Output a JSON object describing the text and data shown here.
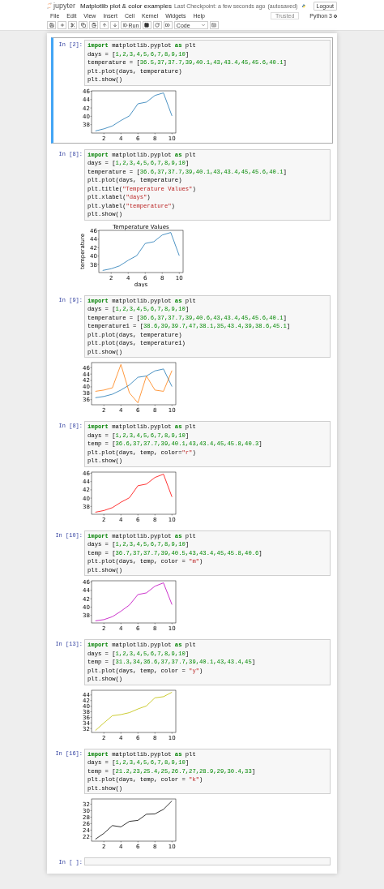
{
  "header": {
    "logo": "jupyter",
    "title": "Matplotlib plot & color examples",
    "checkpoint": "Last Checkpoint: a few seconds ago",
    "autosave": "(autosaved)",
    "logout": "Logout",
    "menu": [
      "File",
      "Edit",
      "View",
      "Insert",
      "Cell",
      "Kernel",
      "Widgets",
      "Help"
    ],
    "trusted": "Trusted",
    "kernel": "Python 3",
    "run": "Run",
    "cell_type": "Code"
  },
  "cells": [
    {
      "prompt": "In [2]:",
      "selected": true,
      "lines": [
        [
          {
            "text": "import",
            "kind": "keyword"
          },
          {
            "text": " matplotlib.pyplot ",
            "kind": "text"
          },
          {
            "text": "as",
            "kind": "keyword"
          },
          {
            "text": " plt",
            "kind": "text"
          }
        ],
        [
          {
            "text": "days = [",
            "kind": "text"
          },
          {
            "text": "1,2,3,4,5,6,7,8,9,10",
            "kind": "number"
          },
          {
            "text": "]",
            "kind": "text"
          }
        ],
        [
          {
            "text": "temperature = [",
            "kind": "text"
          },
          {
            "text": "36.5,37,37.7,39,40.1,43,43.4,45,45.6,40.1",
            "kind": "number"
          },
          {
            "text": "]",
            "kind": "text"
          }
        ],
        [
          {
            "text": "plt.plot(days, temperature)",
            "kind": "text"
          }
        ],
        [
          {
            "text": "plt.show()",
            "kind": "text"
          }
        ]
      ],
      "chart_data": {
        "type": "line",
        "x": [
          1,
          2,
          3,
          4,
          5,
          6,
          7,
          8,
          9,
          10
        ],
        "xlim": [
          0.55,
          10.45
        ],
        "ylim": [
          36,
          46.1
        ],
        "xticks": [
          2,
          4,
          6,
          8,
          10
        ],
        "yticks": [
          38,
          40,
          42,
          44,
          46
        ],
        "series": [
          {
            "color": "#1f77b4",
            "values": [
              36.5,
              37,
              37.7,
              39,
              40.1,
              43,
              43.4,
              45,
              45.6,
              40.1
            ]
          }
        ]
      }
    },
    {
      "prompt": "In [8]:",
      "selected": false,
      "lines": [
        [
          {
            "text": "import",
            "kind": "keyword"
          },
          {
            "text": " matplotlib.pyplot ",
            "kind": "text"
          },
          {
            "text": "as",
            "kind": "keyword"
          },
          {
            "text": " plt",
            "kind": "text"
          }
        ],
        [
          {
            "text": "days = [",
            "kind": "text"
          },
          {
            "text": "1,2,3,4,5,6,7,8,9,10",
            "kind": "number"
          },
          {
            "text": "]",
            "kind": "text"
          }
        ],
        [
          {
            "text": "temperature = [",
            "kind": "text"
          },
          {
            "text": "36.6,37,37.7,39,40.1,43,43.4,45,45.6,40.1",
            "kind": "number"
          },
          {
            "text": "]",
            "kind": "text"
          }
        ],
        [
          {
            "text": "plt.plot(days, temperature)",
            "kind": "text"
          }
        ],
        [
          {
            "text": "plt.title(",
            "kind": "text"
          },
          {
            "text": "\"Temperature Values\"",
            "kind": "string"
          },
          {
            "text": ")",
            "kind": "text"
          }
        ],
        [
          {
            "text": "plt.xlabel(",
            "kind": "text"
          },
          {
            "text": "\"days\"",
            "kind": "string"
          },
          {
            "text": ")",
            "kind": "text"
          }
        ],
        [
          {
            "text": "plt.ylabel(",
            "kind": "text"
          },
          {
            "text": "\"temperature\"",
            "kind": "string"
          },
          {
            "text": ")",
            "kind": "text"
          }
        ],
        [
          {
            "text": "plt.show()",
            "kind": "text"
          }
        ]
      ],
      "chart_data": {
        "type": "line",
        "title": "Temperature Values",
        "xlabel": "days",
        "ylabel": "temperature",
        "x": [
          1,
          2,
          3,
          4,
          5,
          6,
          7,
          8,
          9,
          10
        ],
        "xlim": [
          0.55,
          10.45
        ],
        "ylim": [
          36.1,
          46.1
        ],
        "xticks": [
          2,
          4,
          6,
          8,
          10
        ],
        "yticks": [
          38,
          40,
          42,
          44,
          46
        ],
        "series": [
          {
            "color": "#1f77b4",
            "values": [
              36.6,
              37,
              37.7,
              39,
              40.1,
              43,
              43.4,
              45,
              45.6,
              40.1
            ]
          }
        ]
      }
    },
    {
      "prompt": "In [9]:",
      "selected": false,
      "lines": [
        [
          {
            "text": "import",
            "kind": "keyword"
          },
          {
            "text": " matplotlib.pyplot ",
            "kind": "text"
          },
          {
            "text": "as",
            "kind": "keyword"
          },
          {
            "text": " plt",
            "kind": "text"
          }
        ],
        [
          {
            "text": "days = [",
            "kind": "text"
          },
          {
            "text": "1,2,3,4,5,6,7,8,9,10",
            "kind": "number"
          },
          {
            "text": "]",
            "kind": "text"
          }
        ],
        [
          {
            "text": "temperature = [",
            "kind": "text"
          },
          {
            "text": "36.6,37,37.7,39,40.6,43,43.4,45,45.6,40.1",
            "kind": "number"
          },
          {
            "text": "]",
            "kind": "text"
          }
        ],
        [
          {
            "text": "temperature1 = [",
            "kind": "text"
          },
          {
            "text": "38.6,39,39.7,47,38.1,35,43.4,39,38.6,45.1",
            "kind": "number"
          },
          {
            "text": "]",
            "kind": "text"
          }
        ],
        [
          {
            "text": "plt.plot(days, temperature)",
            "kind": "text"
          }
        ],
        [
          {
            "text": "plt.plot(days, temperature1)",
            "kind": "text"
          }
        ],
        [
          {
            "text": "plt.show()",
            "kind": "text"
          }
        ]
      ],
      "chart_data": {
        "type": "line",
        "x": [
          1,
          2,
          3,
          4,
          5,
          6,
          7,
          8,
          9,
          10
        ],
        "xlim": [
          0.55,
          10.45
        ],
        "ylim": [
          34.4,
          47.6
        ],
        "xticks": [
          2,
          4,
          6,
          8,
          10
        ],
        "yticks": [
          36,
          38,
          40,
          42,
          44,
          46
        ],
        "series": [
          {
            "color": "#1f77b4",
            "values": [
              36.6,
              37,
              37.7,
              39,
              40.6,
              43,
              43.4,
              45,
              45.6,
              40.1
            ]
          },
          {
            "color": "#ff7f0e",
            "values": [
              38.6,
              39,
              39.7,
              47,
              38.1,
              35,
              43.4,
              39,
              38.6,
              45.1
            ]
          }
        ]
      }
    },
    {
      "prompt": "In [8]:",
      "selected": false,
      "lines": [
        [
          {
            "text": "import",
            "kind": "keyword"
          },
          {
            "text": " matplotlib.pyplot ",
            "kind": "text"
          },
          {
            "text": "as",
            "kind": "keyword"
          },
          {
            "text": " plt",
            "kind": "text"
          }
        ],
        [
          {
            "text": "days = [",
            "kind": "text"
          },
          {
            "text": "1,2,3,4,5,6,7,8,9,10",
            "kind": "number"
          },
          {
            "text": "]",
            "kind": "text"
          }
        ],
        [
          {
            "text": "temp = [",
            "kind": "text"
          },
          {
            "text": "36.6,37,37.7,39,40.1,43,43.4,45,45.8,40.3",
            "kind": "number"
          },
          {
            "text": "]",
            "kind": "text"
          }
        ],
        [
          {
            "text": "plt.plot(days, temp, color=",
            "kind": "text"
          },
          {
            "text": "\"r\"",
            "kind": "string"
          },
          {
            "text": ")",
            "kind": "text"
          }
        ],
        [
          {
            "text": "plt.show()",
            "kind": "text"
          }
        ]
      ],
      "chart_data": {
        "type": "line",
        "x": [
          1,
          2,
          3,
          4,
          5,
          6,
          7,
          8,
          9,
          10
        ],
        "xlim": [
          0.55,
          10.45
        ],
        "ylim": [
          36.1,
          46.3
        ],
        "xticks": [
          2,
          4,
          6,
          8,
          10
        ],
        "yticks": [
          38,
          40,
          42,
          44,
          46
        ],
        "series": [
          {
            "color": "#ff0000",
            "values": [
              36.6,
              37,
              37.7,
              39,
              40.1,
              43,
              43.4,
              45,
              45.8,
              40.3
            ]
          }
        ]
      }
    },
    {
      "prompt": "In [10]:",
      "selected": false,
      "lines": [
        [
          {
            "text": "import",
            "kind": "keyword"
          },
          {
            "text": " matplotlib.pyplot ",
            "kind": "text"
          },
          {
            "text": "as",
            "kind": "keyword"
          },
          {
            "text": " plt",
            "kind": "text"
          }
        ],
        [
          {
            "text": "days = [",
            "kind": "text"
          },
          {
            "text": "1,2,3,4,5,6,7,8,9,10",
            "kind": "number"
          },
          {
            "text": "]",
            "kind": "text"
          }
        ],
        [
          {
            "text": "temp = [",
            "kind": "text"
          },
          {
            "text": "36.7,37,37.7,39,40.5,43,43.4,45,45.8,40.6",
            "kind": "number"
          },
          {
            "text": "]",
            "kind": "text"
          }
        ],
        [
          {
            "text": "plt.plot(days, temp, color = ",
            "kind": "text"
          },
          {
            "text": "\"m\"",
            "kind": "string"
          },
          {
            "text": ")",
            "kind": "text"
          }
        ],
        [
          {
            "text": "plt.show()",
            "kind": "text"
          }
        ]
      ],
      "chart_data": {
        "type": "line",
        "x": [
          1,
          2,
          3,
          4,
          5,
          6,
          7,
          8,
          9,
          10
        ],
        "xlim": [
          0.55,
          10.45
        ],
        "ylim": [
          36.2,
          46.3
        ],
        "xticks": [
          2,
          4,
          6,
          8,
          10
        ],
        "yticks": [
          38,
          40,
          42,
          44,
          46
        ],
        "series": [
          {
            "color": "#bf00bf",
            "values": [
              36.7,
              37,
              37.7,
              39,
              40.5,
              43,
              43.4,
              45,
              45.8,
              40.6
            ]
          }
        ]
      }
    },
    {
      "prompt": "In [13]:",
      "selected": false,
      "lines": [
        [
          {
            "text": "import",
            "kind": "keyword"
          },
          {
            "text": " matplotlib.pyplot ",
            "kind": "text"
          },
          {
            "text": "as",
            "kind": "keyword"
          },
          {
            "text": " plt",
            "kind": "text"
          }
        ],
        [
          {
            "text": "days = [",
            "kind": "text"
          },
          {
            "text": "1,2,3,4,5,6,7,8,9,10",
            "kind": "number"
          },
          {
            "text": "]",
            "kind": "text"
          }
        ],
        [
          {
            "text": "temp = [",
            "kind": "text"
          },
          {
            "text": "31.3,34,36.6,37,37.7,39,40.1,43,43.4,45",
            "kind": "number"
          },
          {
            "text": "]",
            "kind": "text"
          }
        ],
        [
          {
            "text": "plt.plot(days, temp, color = ",
            "kind": "text"
          },
          {
            "text": "\"y\"",
            "kind": "string"
          },
          {
            "text": ")",
            "kind": "text"
          }
        ],
        [
          {
            "text": "plt.show()",
            "kind": "text"
          }
        ]
      ],
      "chart_data": {
        "type": "line",
        "x": [
          1,
          2,
          3,
          4,
          5,
          6,
          7,
          8,
          9,
          10
        ],
        "xlim": [
          0.55,
          10.45
        ],
        "ylim": [
          30.6,
          45.7
        ],
        "xticks": [
          2,
          4,
          6,
          8,
          10
        ],
        "yticks": [
          32,
          34,
          36,
          38,
          40,
          42,
          44
        ],
        "series": [
          {
            "color": "#bfbf00",
            "values": [
              31.3,
              34,
              36.6,
              37,
              37.7,
              39,
              40.1,
              43,
              43.4,
              45
            ]
          }
        ]
      }
    },
    {
      "prompt": "In [16]:",
      "selected": false,
      "lines": [
        [
          {
            "text": "import",
            "kind": "keyword"
          },
          {
            "text": " matplotlib.pyplot ",
            "kind": "text"
          },
          {
            "text": "as",
            "kind": "keyword"
          },
          {
            "text": " plt",
            "kind": "text"
          }
        ],
        [
          {
            "text": "days = [",
            "kind": "text"
          },
          {
            "text": "1,2,3,4,5,6,7,8,9,10",
            "kind": "number"
          },
          {
            "text": "]",
            "kind": "text"
          }
        ],
        [
          {
            "text": "temp = [",
            "kind": "text"
          },
          {
            "text": "21.2,23,25.4,25,26.7,27,28.9,29,30.4,33",
            "kind": "number"
          },
          {
            "text": "]",
            "kind": "text"
          }
        ],
        [
          {
            "text": "plt.plot(days, temp, color = ",
            "kind": "text"
          },
          {
            "text": "\"k\"",
            "kind": "string"
          },
          {
            "text": ")",
            "kind": "text"
          }
        ],
        [
          {
            "text": "plt.show()",
            "kind": "text"
          }
        ]
      ],
      "chart_data": {
        "type": "line",
        "x": [
          1,
          2,
          3,
          4,
          5,
          6,
          7,
          8,
          9,
          10
        ],
        "xlim": [
          0.55,
          10.45
        ],
        "ylim": [
          20.6,
          33.6
        ],
        "xticks": [
          2,
          4,
          6,
          8,
          10
        ],
        "yticks": [
          22,
          24,
          26,
          28,
          30,
          32
        ],
        "series": [
          {
            "color": "#000000",
            "values": [
              21.2,
              23,
              25.4,
              25,
              26.7,
              27,
              28.9,
              29,
              30.4,
              33
            ]
          }
        ]
      }
    },
    {
      "prompt": "In [ ]:",
      "selected": false
    }
  ]
}
